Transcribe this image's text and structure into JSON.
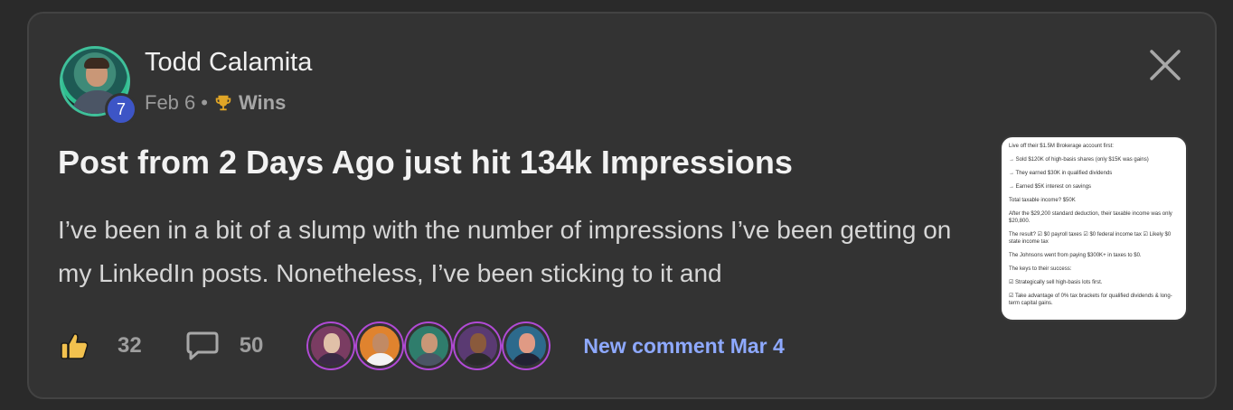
{
  "post": {
    "author": "Todd Calamita",
    "level": "7",
    "date": "Feb 6",
    "separator": "•",
    "category": "Wins",
    "title": "Post from 2 Days Ago just hit 134k Impressions",
    "excerpt": "I’ve been in a bit of a slump with the number of impressions I’ve been getting on my LinkedIn posts. Nonetheless, I’ve been sticking to it and"
  },
  "thumbnail": {
    "lines": [
      "Live off their $1.5M Brokerage account first:",
      "→ Sold $120K of high-basis shares (only $15K was gains)",
      "→ They earned $30K in qualified dividends",
      "→ Earned $5K interest on savings",
      "Total taxable income? $50K",
      "After the $29,200 standard deduction, their taxable income was only $20,800.",
      "The result? ☑ $0 payroll taxes ☑ $0 federal income tax ☑ Likely $0 state income tax",
      "The Johnsons went from paying $300K+ in taxes to $0.",
      "The keys to their success:",
      "☑ Strategically sell high-basis lots first.",
      "☑ Take advantage of 0% tax brackets for qualified dividends & long-term capital gains."
    ]
  },
  "footer": {
    "likes": "32",
    "comments": "50",
    "new_comment": "New comment Mar 4"
  },
  "icons": {
    "like": "thumbs-up-icon",
    "comment": "comment-bubble-icon",
    "close": "close-icon",
    "trophy": "trophy-icon"
  },
  "colors": {
    "background": "#2a2a2a",
    "card": "#333333",
    "accent_link": "#8ea9ff",
    "level_badge": "#3d55c6",
    "like_icon": "#f2c14e"
  }
}
